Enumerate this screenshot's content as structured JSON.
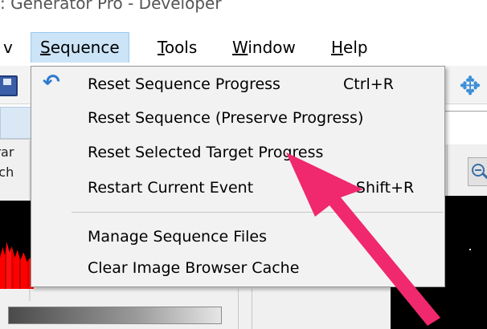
{
  "window": {
    "title": ": Generator Pro - Developer"
  },
  "menubar": {
    "items": [
      {
        "label": "v",
        "mnemonic_first": "",
        "rest": "v"
      },
      {
        "label": "Sequence",
        "mnemonic_first": "S",
        "rest": "equence"
      },
      {
        "label": "Tools",
        "mnemonic_first": "T",
        "rest": "ools"
      },
      {
        "label": "Window",
        "mnemonic_first": "W",
        "rest": "indow"
      },
      {
        "label": "Help",
        "mnemonic_first": "H",
        "rest": "elp"
      }
    ]
  },
  "sequence_menu": {
    "items": [
      {
        "label": "Reset Sequence Progress",
        "shortcut": "Ctrl+R"
      },
      {
        "label": "Reset Sequence (Preserve Progress)",
        "shortcut": ""
      },
      {
        "label": "Reset Selected Target Progress",
        "shortcut": ""
      },
      {
        "label": "Restart Current Event",
        "shortcut": "+Shift+R"
      },
      {
        "label": "Manage Sequence Files",
        "shortcut": ""
      },
      {
        "label": "Clear Image Browser Cache",
        "shortcut": ""
      }
    ]
  },
  "left_panel": {
    "label_1": "ırar",
    "label_2": "tch"
  },
  "icons": {
    "save": "save-icon",
    "undo": "undo-icon",
    "move": "move-icon",
    "zoom": "zoom-out-icon"
  },
  "colors": {
    "menu_highlight": "#cce4f7",
    "annotation_arrow": "#f0286e",
    "histogram": "#ff0000"
  },
  "progress": {
    "fill_fraction": 1.0
  }
}
